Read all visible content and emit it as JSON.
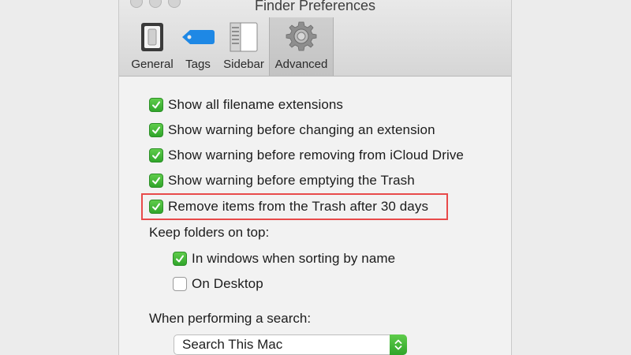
{
  "window": {
    "title": "Finder Preferences"
  },
  "toolbar": {
    "tabs": [
      {
        "label": "General",
        "icon": "general-switch-icon"
      },
      {
        "label": "Tags",
        "icon": "tag-icon"
      },
      {
        "label": "Sidebar",
        "icon": "sidebar-icon"
      },
      {
        "label": "Advanced",
        "icon": "gear-icon",
        "selected": true
      }
    ]
  },
  "options": [
    {
      "label": "Show all filename extensions",
      "checked": true
    },
    {
      "label": "Show warning before changing an extension",
      "checked": true
    },
    {
      "label": "Show warning before removing from iCloud Drive",
      "checked": true
    },
    {
      "label": "Show warning before emptying the Trash",
      "checked": true
    },
    {
      "label": "Remove items from the Trash after 30 days",
      "checked": true,
      "highlighted": true
    }
  ],
  "keep_folders": {
    "heading": "Keep folders on top:",
    "items": [
      {
        "label": "In windows when sorting by name",
        "checked": true
      },
      {
        "label": "On Desktop",
        "checked": false
      }
    ]
  },
  "search": {
    "heading": "When performing a search:",
    "selected": "Search This Mac"
  },
  "colors": {
    "checkbox_on": "#2fa52a",
    "highlight": "#e84a4a"
  }
}
